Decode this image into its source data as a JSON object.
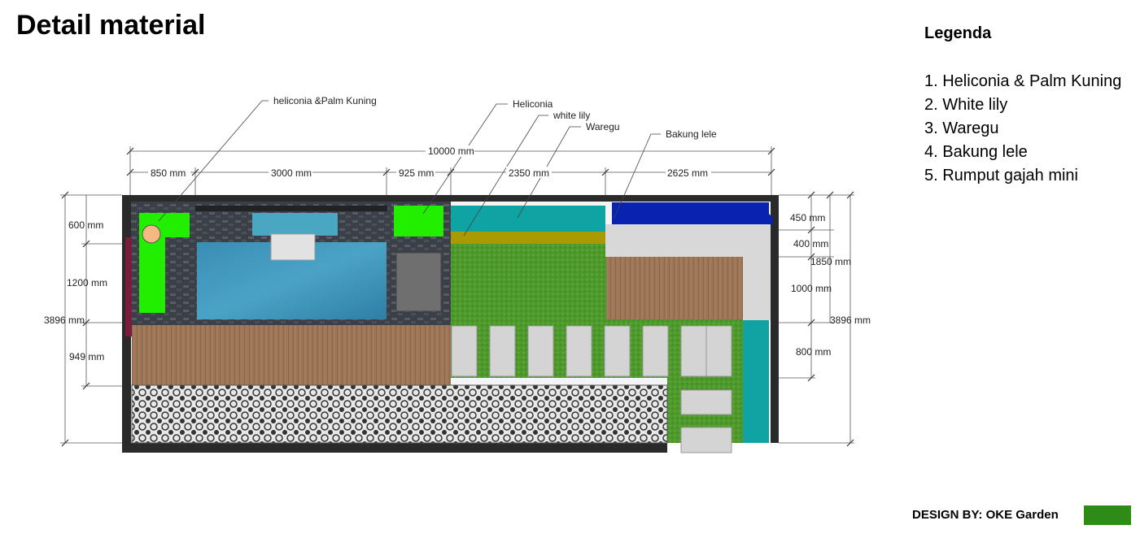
{
  "title": "Detail material",
  "legend": {
    "title": "Legenda",
    "items": [
      "1. Heliconia & Palm Kuning",
      "2. White lily",
      "3. Waregu",
      "4. Bakung lele",
      "5. Rumput gajah mini"
    ]
  },
  "credit": "DESIGN BY: OKE Garden",
  "colors": {
    "grass": "#4e9a2a",
    "pond": "#3f8fb5",
    "wood": "#9c7656",
    "teal_bed": "#0fa3a3",
    "blue_bed": "#0a22b0",
    "bright_green": "#22ee00",
    "olive_strip": "#a89a00",
    "stone": "#d8d8d8",
    "wall": "#2a2a2a",
    "credit_swatch": "#2e8b17"
  },
  "plant_callouts": [
    "heliconia &Palm Kuning",
    "Heliconia",
    "white lily",
    "Waregu",
    "Bakung lele"
  ],
  "dimensions": {
    "top_total": "10000 mm",
    "top_segments": [
      "850 mm",
      "3000 mm",
      "925 mm",
      "2350 mm",
      "2625 mm"
    ],
    "left": [
      "600 mm",
      "1200 mm",
      "3896 mm",
      "949 mm"
    ],
    "right": [
      "450 mm",
      "400 mm",
      "1850 mm",
      "1000 mm",
      "3896 mm",
      "800 mm"
    ]
  }
}
